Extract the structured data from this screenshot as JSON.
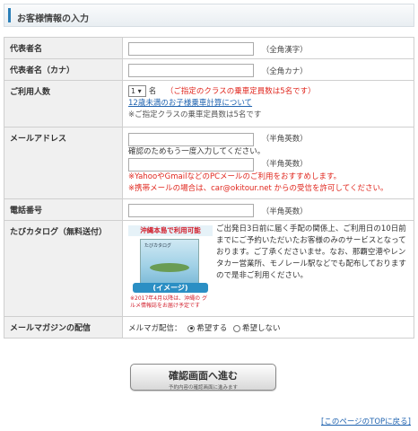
{
  "section_title": "お客様情報の入力",
  "fields": {
    "name": {
      "label": "代表者名",
      "note": "（全角漢字）"
    },
    "kana": {
      "label": "代表者名（カナ）",
      "note": "（全角カナ）"
    },
    "people": {
      "label": "ご利用人数",
      "value": "1",
      "unit": "名",
      "warning": "（ご指定のクラスの乗車定員数は5名です）",
      "link": "12歳未満のお子様乗車計算について",
      "capacity_note": "※ご指定クラスの乗車定員数は5名です"
    },
    "email": {
      "label": "メールアドレス",
      "note": "（半角英数）",
      "confirm_text": "確認のためもう一度入力してください。",
      "note2": "（半角英数）",
      "warn1": "※YahooやGmailなどのPCメールのご利用をおすすめします。",
      "warn2": "※携帯メールの場合は、car@okitour.net からの受信を許可してください。"
    },
    "phone": {
      "label": "電話番号",
      "note": "（半角英数）"
    },
    "catalog": {
      "label": "たびカタログ（無料送付）",
      "image_header": "沖縄本島で利用可能",
      "cover_title": "たびカタログ",
      "banner": "(イメージ)",
      "image_note": "※2017年4月以降は、沖縄の グルメ情報誌をお届け予定です",
      "description": "ご出発日3日前に届く手配の関係上、ご利用日の10日前までにご予約いただいたお客様のみのサービスとなっております。ご了承くださいませ。なお、那覇空港やレンタカー営業所、モノレール駅などでも配布しておりますので是非ご利用ください。"
    },
    "magazine": {
      "label": "メールマガジンの配信",
      "prefix": "メルマガ配信：",
      "opt_yes": "希望する",
      "opt_no": "希望しない"
    }
  },
  "confirm_button": {
    "label": "確認画面へ進む",
    "sub": "予約内容の確認画面に進みます"
  },
  "top_link": "[このページのTOPに戻る]"
}
